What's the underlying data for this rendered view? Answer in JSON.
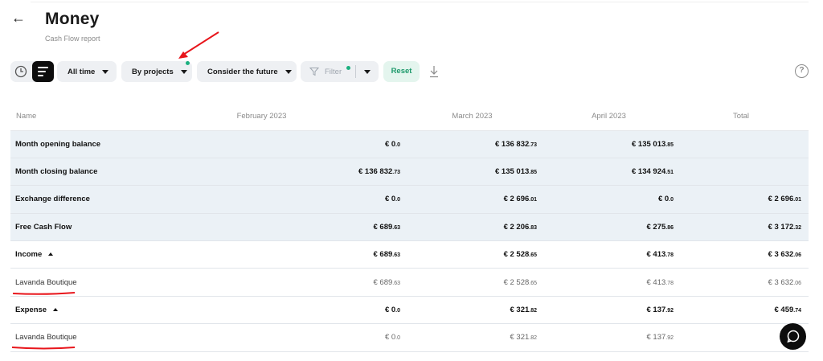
{
  "header": {
    "back_icon": "arrow-left-icon",
    "title": "Money",
    "subtitle": "Cash Flow report"
  },
  "toolbar": {
    "period": "All time",
    "grouping": "By projects",
    "future": "Consider the future",
    "filter_label": "Filter",
    "reset_label": "Reset",
    "accent_color": "#1bb07f"
  },
  "table": {
    "columns": [
      "Name",
      "February 2023",
      "March 2023",
      "April 2023",
      "Total"
    ],
    "rows": [
      {
        "name": "Month opening balance",
        "kind": "hl",
        "cells": [
          [
            "€ 0",
            ".0"
          ],
          [
            "€ 136 832",
            ".73"
          ],
          [
            "€ 135 013",
            ".85"
          ],
          [
            "",
            ""
          ]
        ]
      },
      {
        "name": "Month closing balance",
        "kind": "hl",
        "cells": [
          [
            "€ 136 832",
            ".73"
          ],
          [
            "€ 135 013",
            ".85"
          ],
          [
            "€ 134 924",
            ".51"
          ],
          [
            "",
            ""
          ]
        ]
      },
      {
        "name": "Exchange difference",
        "kind": "hl",
        "cells": [
          [
            "€ 0",
            ".0"
          ],
          [
            "€ 2 696",
            ".01"
          ],
          [
            "€ 0",
            ".0"
          ],
          [
            "€ 2 696",
            ".01"
          ]
        ]
      },
      {
        "name": "Free Cash Flow",
        "kind": "hl",
        "cells": [
          [
            "€ 689",
            ".63"
          ],
          [
            "€ 2 206",
            ".83"
          ],
          [
            "€ 275",
            ".86"
          ],
          [
            "€ 3 172",
            ".32"
          ]
        ]
      },
      {
        "name": "Income",
        "kind": "sec",
        "cells": [
          [
            "€ 689",
            ".63"
          ],
          [
            "€ 2 528",
            ".65"
          ],
          [
            "€ 413",
            ".78"
          ],
          [
            "€ 3 632",
            ".06"
          ]
        ]
      },
      {
        "name": "Lavanda Boutique",
        "kind": "item",
        "cells": [
          [
            "€ 689",
            ".63"
          ],
          [
            "€ 2 528",
            ".65"
          ],
          [
            "€ 413",
            ".78"
          ],
          [
            "€ 3 632",
            ".06"
          ]
        ]
      },
      {
        "name": "Expense",
        "kind": "sec",
        "cells": [
          [
            "€ 0",
            ".0"
          ],
          [
            "€ 321",
            ".82"
          ],
          [
            "€ 137",
            ".92"
          ],
          [
            "€ 459",
            ".74"
          ]
        ]
      },
      {
        "name": "Lavanda Boutique",
        "kind": "item",
        "cells": [
          [
            "€ 0",
            ".0"
          ],
          [
            "€ 321",
            ".82"
          ],
          [
            "€ 137",
            ".92"
          ],
          [
            "€",
            ""
          ]
        ]
      }
    ]
  },
  "annotation_color": "#e8151b"
}
